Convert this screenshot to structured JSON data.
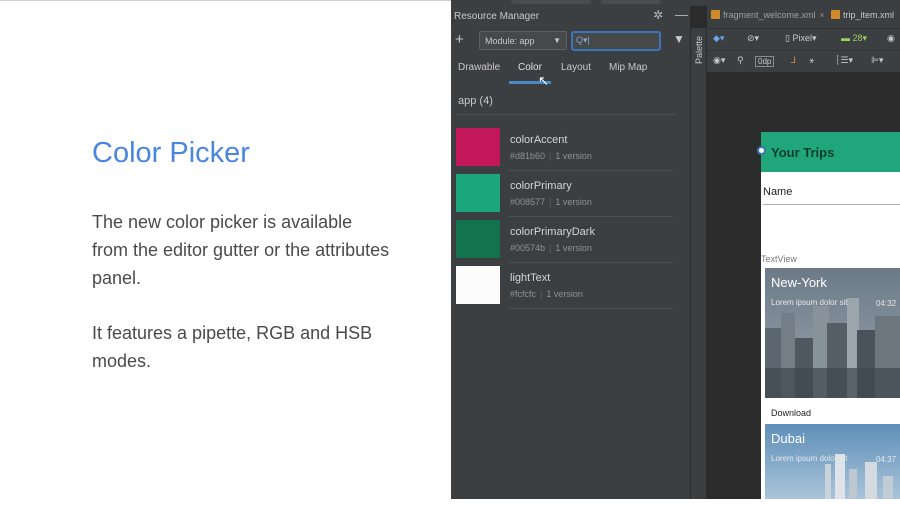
{
  "slide": {
    "title": "Color Picker",
    "paragraph1": "The new color picker is available from the editor gutter or the attributes panel.",
    "paragraph2": "It features a pipette, RGB and HSB modes."
  },
  "resource_manager": {
    "title": "Resource Manager",
    "settings_icon": "gear-icon",
    "minimize_icon": "minus-icon",
    "add_icon": "plus-icon",
    "module_select": "Module: app",
    "search_value": "",
    "filter_icon": "funnel-icon",
    "tabs": [
      {
        "label": "Drawable",
        "active": false
      },
      {
        "label": "Color",
        "active": true
      },
      {
        "label": "Layout",
        "active": false
      },
      {
        "label": "Mip Map",
        "active": false
      }
    ],
    "group_label": "app (4)",
    "resources": [
      {
        "name": "colorAccent",
        "hex": "#d81b60",
        "versions": "1 version",
        "swatch": "#c2185b"
      },
      {
        "name": "colorPrimary",
        "hex": "#008577",
        "versions": "1 version",
        "swatch": "#1ba77c"
      },
      {
        "name": "colorPrimaryDark",
        "hex": "#00574b",
        "versions": "1 version",
        "swatch": "#14734f"
      },
      {
        "name": "lightText",
        "hex": "#fcfcfc",
        "versions": "1 version",
        "swatch": "#fcfcfc"
      }
    ]
  },
  "palette": {
    "label": "Palette"
  },
  "editor": {
    "tabs": [
      {
        "label": "fragment_welcome.xml",
        "has_close": true
      },
      {
        "label": "trip_item.xml",
        "has_close": false
      }
    ],
    "toolbar1": {
      "device": "Pixel",
      "api": "28"
    },
    "toolbar2": {
      "margin": "0dp"
    }
  },
  "preview": {
    "appbar_title": "Your Trips",
    "name_label": "Name",
    "textview_label": "TextView",
    "cards": [
      {
        "title": "New-York",
        "subtitle": "Lorem ipsum dolor sit",
        "time": "04:32",
        "action": "Download"
      },
      {
        "title": "Dubai",
        "subtitle": "Lorem ipsum dolor sit",
        "time": "04:37",
        "action": ""
      }
    ]
  },
  "colors": {
    "title_blue": "#4a86e0",
    "ide_bg": "#2b2b2b",
    "panel_bg": "#3c3f41",
    "accent_blue": "#4a88c7",
    "appbar_green": "#20a67a"
  }
}
